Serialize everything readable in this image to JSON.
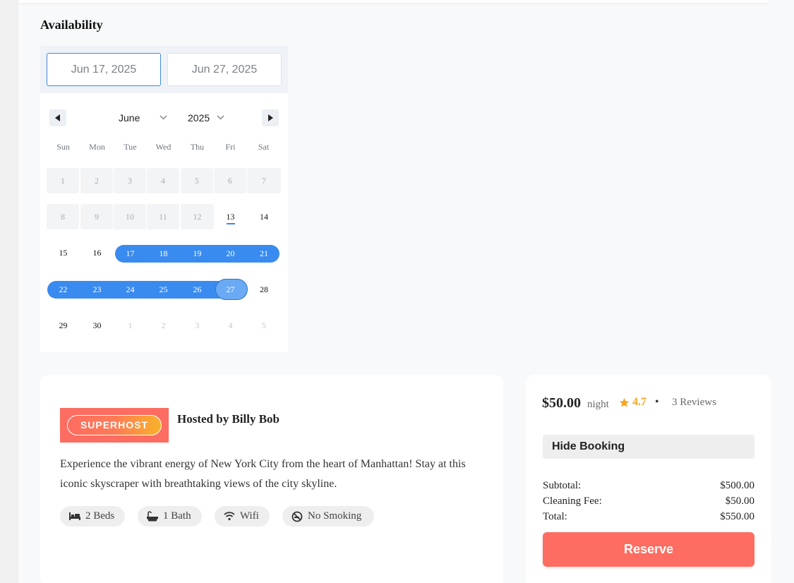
{
  "availability": {
    "title": "Availability",
    "start_date": "Jun 17, 2025",
    "end_date": "Jun 27, 2025",
    "month": "June",
    "year": "2025",
    "weekdays": [
      "Sun",
      "Mon",
      "Tue",
      "Wed",
      "Thu",
      "Fri",
      "Sat"
    ],
    "weeks": [
      [
        "1",
        "2",
        "3",
        "4",
        "5",
        "6",
        "7"
      ],
      [
        "8",
        "9",
        "10",
        "11",
        "12",
        "13",
        "14"
      ],
      [
        "15",
        "16",
        "17",
        "18",
        "19",
        "20",
        "21"
      ],
      [
        "22",
        "23",
        "24",
        "25",
        "26",
        "27",
        "28"
      ],
      [
        "29",
        "30",
        "1",
        "2",
        "3",
        "4",
        "5"
      ]
    ]
  },
  "host": {
    "badge": "SUPERHOST",
    "hosted_by": "Hosted by Billy Bob",
    "description": "Experience the vibrant energy of New York City from the heart of Manhattan! Stay at this iconic skyscraper with breathtaking views of the city skyline.",
    "amenities": [
      {
        "label": "2 Beds",
        "icon": "bed-icon"
      },
      {
        "label": "1 Bath",
        "icon": "bath-icon"
      },
      {
        "label": "Wifi",
        "icon": "wifi-icon"
      },
      {
        "label": "No Smoking",
        "icon": "no-smoking-icon"
      }
    ]
  },
  "booking": {
    "price": "$50.00",
    "per": "night",
    "rating": "4.7",
    "separator": "•",
    "reviews": "3 Reviews",
    "hide_label": "Hide Booking",
    "subtotal_label": "Subtotal:",
    "subtotal_value": "$500.00",
    "cleaning_label": "Cleaning Fee:",
    "cleaning_value": "$50.00",
    "total_label": "Total:",
    "total_value": "$550.00",
    "reserve_label": "Reserve"
  },
  "colors": {
    "accent_blue": "#3a8bef",
    "brand_coral": "#fd6d61",
    "star_gold": "#f5a623"
  }
}
